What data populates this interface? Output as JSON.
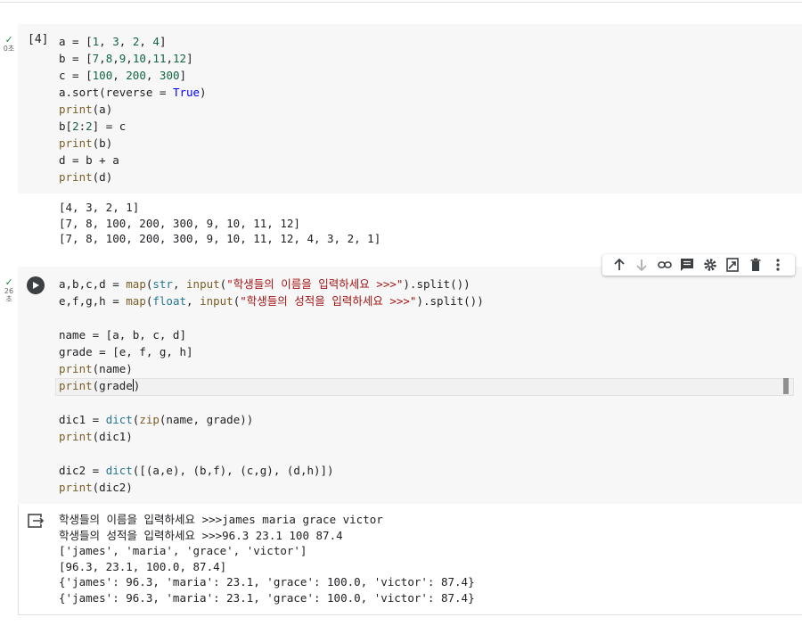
{
  "cell1": {
    "exec_count": "[4]",
    "exec_time": "0초",
    "code": [
      [
        {
          "t": "a = ["
        },
        {
          "t": "1",
          "c": "num"
        },
        {
          "t": ", "
        },
        {
          "t": "3",
          "c": "num"
        },
        {
          "t": ", "
        },
        {
          "t": "2",
          "c": "num"
        },
        {
          "t": ", "
        },
        {
          "t": "4",
          "c": "num"
        },
        {
          "t": "]"
        }
      ],
      [
        {
          "t": "b = ["
        },
        {
          "t": "7",
          "c": "num"
        },
        {
          "t": ","
        },
        {
          "t": "8",
          "c": "num"
        },
        {
          "t": ","
        },
        {
          "t": "9",
          "c": "num"
        },
        {
          "t": ","
        },
        {
          "t": "10",
          "c": "num"
        },
        {
          "t": ","
        },
        {
          "t": "11",
          "c": "num"
        },
        {
          "t": ","
        },
        {
          "t": "12",
          "c": "num"
        },
        {
          "t": "]"
        }
      ],
      [
        {
          "t": "c = ["
        },
        {
          "t": "100",
          "c": "num"
        },
        {
          "t": ", "
        },
        {
          "t": "200",
          "c": "num"
        },
        {
          "t": ", "
        },
        {
          "t": "300",
          "c": "num"
        },
        {
          "t": "]"
        }
      ],
      [
        {
          "t": "a.sort(reverse = "
        },
        {
          "t": "True",
          "c": "kw"
        },
        {
          "t": ")"
        }
      ],
      [
        {
          "t": "print",
          "c": "fn"
        },
        {
          "t": "(a)"
        }
      ],
      [
        {
          "t": "b["
        },
        {
          "t": "2",
          "c": "num"
        },
        {
          "t": ":"
        },
        {
          "t": "2",
          "c": "num"
        },
        {
          "t": "] = c"
        }
      ],
      [
        {
          "t": "print",
          "c": "fn"
        },
        {
          "t": "(b)"
        }
      ],
      [
        {
          "t": "d = b + a"
        }
      ],
      [
        {
          "t": "print",
          "c": "fn"
        },
        {
          "t": "(d)"
        }
      ]
    ],
    "output": [
      "[4, 3, 2, 1]",
      "[7, 8, 100, 200, 300, 9, 10, 11, 12]",
      "[7, 8, 100, 200, 300, 9, 10, 11, 12, 4, 3, 2, 1]"
    ]
  },
  "cell2": {
    "exec_time": "26\n초",
    "code": [
      [
        {
          "t": "a,b,c,d = "
        },
        {
          "t": "map",
          "c": "fn"
        },
        {
          "t": "("
        },
        {
          "t": "str",
          "c": "builtin"
        },
        {
          "t": ", "
        },
        {
          "t": "input",
          "c": "fn"
        },
        {
          "t": "("
        },
        {
          "t": "\"학생들의 이름을 입력하세요 >>>\"",
          "c": "str"
        },
        {
          "t": ").split())"
        }
      ],
      [
        {
          "t": "e,f,g,h = "
        },
        {
          "t": "map",
          "c": "fn"
        },
        {
          "t": "("
        },
        {
          "t": "float",
          "c": "builtin"
        },
        {
          "t": ", "
        },
        {
          "t": "input",
          "c": "fn"
        },
        {
          "t": "("
        },
        {
          "t": "\"학생들의 성적을 입력하세요 >>>\"",
          "c": "str"
        },
        {
          "t": ").split())"
        }
      ],
      [],
      [
        {
          "t": "name = [a, b, c, d]"
        }
      ],
      [
        {
          "t": "grade = [e, f, g, h]"
        }
      ],
      [
        {
          "t": "print",
          "c": "fn"
        },
        {
          "t": "(name)"
        }
      ],
      [
        {
          "t": "print",
          "c": "fn"
        },
        {
          "t": "(grade"
        },
        {
          "t": "|",
          "c": "cursor"
        },
        {
          "t": ")"
        }
      ],
      [],
      [
        {
          "t": "dic1 = "
        },
        {
          "t": "dict",
          "c": "builtin"
        },
        {
          "t": "("
        },
        {
          "t": "zip",
          "c": "fn"
        },
        {
          "t": "(name, grade))"
        }
      ],
      [
        {
          "t": "print",
          "c": "fn"
        },
        {
          "t": "(dic1)"
        }
      ],
      [],
      [
        {
          "t": "dic2 = "
        },
        {
          "t": "dict",
          "c": "builtin"
        },
        {
          "t": "([(a,e), (b,f), (c,g), (d,h)])"
        }
      ],
      [
        {
          "t": "print",
          "c": "fn"
        },
        {
          "t": "(dic2)"
        }
      ]
    ],
    "output": [
      "학생들의 이름을 입력하세요 >>>james maria grace victor",
      "학생들의 성적을 입력하세요 >>>96.3 23.1 100 87.4",
      "['james', 'maria', 'grace', 'victor']",
      "[96.3, 23.1, 100.0, 87.4]",
      "{'james': 96.3, 'maria': 23.1, 'grace': 100.0, 'victor': 87.4}",
      "{'james': 96.3, 'maria': 23.1, 'grace': 100.0, 'victor': 87.4}"
    ]
  },
  "toolbar": {
    "icons": [
      "arrow-up-icon",
      "arrow-down-icon",
      "link-icon",
      "comment-icon",
      "gear-icon",
      "mirror-cell-icon",
      "trash-icon",
      "more-vert-icon"
    ]
  },
  "colors": {
    "cell_bg": "#f7f7f7",
    "keyword": "#0000ff",
    "function": "#795e26",
    "number": "#116644",
    "string": "#a31515",
    "builtin": "#257693",
    "success": "#188038"
  }
}
